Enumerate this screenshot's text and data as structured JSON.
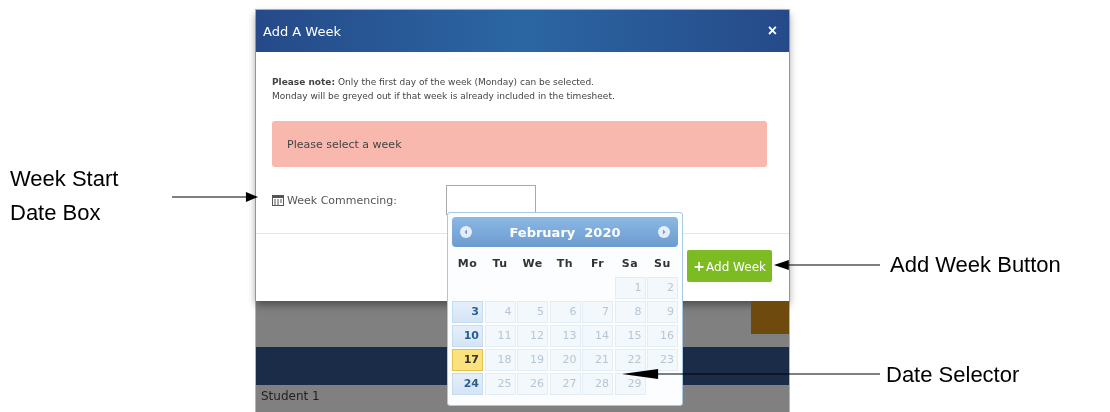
{
  "annotations": [
    {
      "label": "Week Start\nDate Box",
      "kind": "left"
    },
    {
      "label": "Add Week Button",
      "kind": "right"
    },
    {
      "label": "Date Selector",
      "kind": "right"
    }
  ],
  "dialog": {
    "title": "Add A Week",
    "close": "×",
    "note_bold": "Please note:",
    "note": "Only the first day of the week (Monday) can be selected.\nMonday will be greyed out if that week is already included in the timesheet.",
    "alert": "Please select a week",
    "field_label": "Week Commencing:",
    "button": "Add Week",
    "button_icon": "+"
  },
  "background": {
    "row_label": "Student 1"
  },
  "datepicker": {
    "month": "February",
    "year": "2020",
    "weekdays": [
      "Mo",
      "Tu",
      "We",
      "Th",
      "Fr",
      "Sa",
      "Su"
    ],
    "weeks": [
      {
        "days": [
          {
            "label": "1",
            "selectable": false,
            "highlighted": false
          },
          {
            "label": "2",
            "selectable": false,
            "highlighted": false
          }
        ]
      },
      {
        "days": [
          {
            "label": "3",
            "selectable": true,
            "highlighted": false
          },
          {
            "label": "4",
            "selectable": false,
            "highlighted": false
          },
          {
            "label": "5",
            "selectable": false,
            "highlighted": false
          },
          {
            "label": "6",
            "selectable": false,
            "highlighted": false
          },
          {
            "label": "7",
            "selectable": false,
            "highlighted": false
          },
          {
            "label": "8",
            "selectable": false,
            "highlighted": false
          },
          {
            "label": "9",
            "selectable": false,
            "highlighted": false
          }
        ]
      },
      {
        "days": [
          {
            "label": "10",
            "selectable": true,
            "highlighted": false
          },
          {
            "label": "11",
            "selectable": false,
            "highlighted": false
          },
          {
            "label": "12",
            "selectable": false,
            "highlighted": false
          },
          {
            "label": "13",
            "selectable": false,
            "highlighted": false
          },
          {
            "label": "14",
            "selectable": false,
            "highlighted": false
          },
          {
            "label": "15",
            "selectable": false,
            "highlighted": false
          },
          {
            "label": "16",
            "selectable": false,
            "highlighted": false
          }
        ]
      },
      {
        "days": [
          {
            "label": "17",
            "selectable": true,
            "highlighted": true
          },
          {
            "label": "18",
            "selectable": false,
            "highlighted": false
          },
          {
            "label": "19",
            "selectable": false,
            "highlighted": false
          },
          {
            "label": "20",
            "selectable": false,
            "highlighted": false
          },
          {
            "label": "21",
            "selectable": false,
            "highlighted": false
          },
          {
            "label": "22",
            "selectable": false,
            "highlighted": false
          },
          {
            "label": "23",
            "selectable": false,
            "highlighted": false
          }
        ]
      },
      {
        "days": [
          {
            "label": "24",
            "selectable": true,
            "highlighted": false
          },
          {
            "label": "25",
            "selectable": false,
            "highlighted": false
          },
          {
            "label": "26",
            "selectable": false,
            "highlighted": false
          },
          {
            "label": "27",
            "selectable": false,
            "highlighted": false
          },
          {
            "label": "28",
            "selectable": false,
            "highlighted": false
          },
          {
            "label": "29",
            "selectable": false,
            "highlighted": false
          }
        ]
      }
    ]
  }
}
